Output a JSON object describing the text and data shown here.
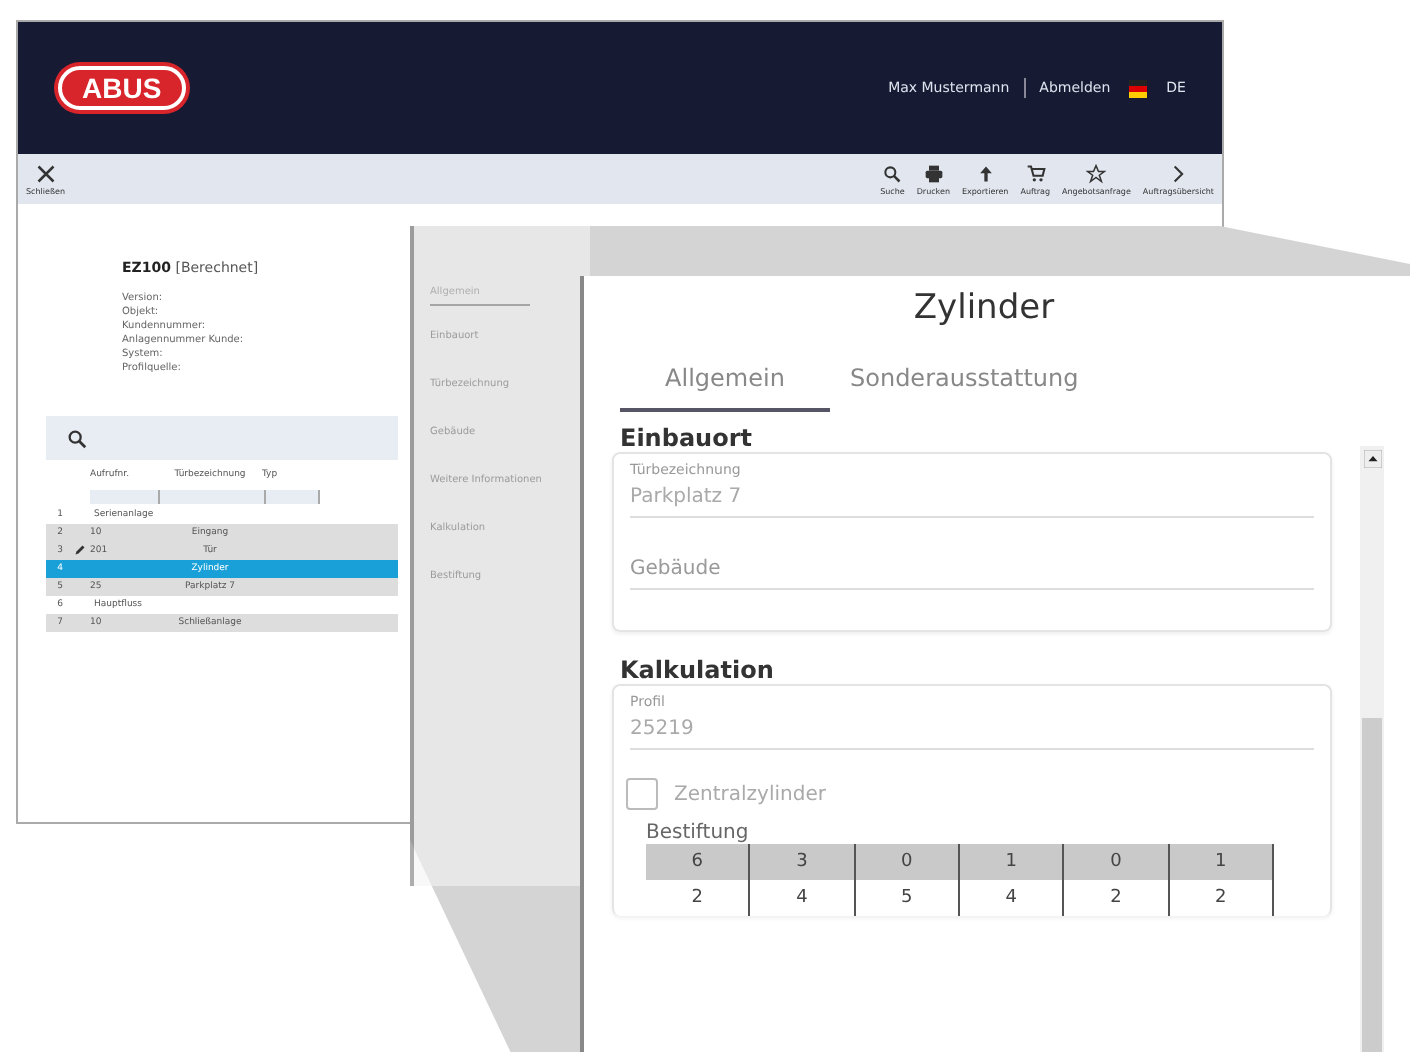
{
  "header": {
    "logo": "ABUS",
    "user": "Max Mustermann",
    "logout": "Abmelden",
    "language": "DE"
  },
  "toolbar": {
    "close": "Schließen",
    "actions": [
      {
        "kind": "search",
        "label": "Suche"
      },
      {
        "kind": "print",
        "label": "Drucken"
      },
      {
        "kind": "export",
        "label": "Exportieren"
      },
      {
        "kind": "cart",
        "label": "Auftrag"
      },
      {
        "kind": "star",
        "label": "Angebotsanfrage"
      },
      {
        "kind": "next",
        "label": "Auftragsübersicht"
      }
    ]
  },
  "object_card": {
    "title": "EZ100",
    "status": "[Berechnet]",
    "fields": [
      "Version:",
      "Objekt:",
      "Kundennummer:",
      "Anlagennummer Kunde:",
      "System:",
      "Profilquelle:"
    ]
  },
  "door_table": {
    "columns": [
      "Aufrufnr.",
      "Türbezeichnung",
      "Typ"
    ],
    "rows": [
      {
        "number": "1",
        "kind": "group",
        "editing": false,
        "selected": false,
        "cells": [
          "Serienanlage"
        ]
      },
      {
        "number": "2",
        "kind": "item",
        "editing": false,
        "selected": false,
        "cells": [
          "10",
          "Eingang"
        ]
      },
      {
        "number": "3",
        "kind": "item",
        "editing": true,
        "selected": false,
        "cells": [
          "201",
          "Tür"
        ]
      },
      {
        "number": "4",
        "kind": "item",
        "editing": false,
        "selected": true,
        "cells": [
          "",
          "Zylinder"
        ]
      },
      {
        "number": "5",
        "kind": "item",
        "editing": false,
        "selected": false,
        "cells": [
          "25",
          "Parkplatz 7"
        ]
      },
      {
        "number": "6",
        "kind": "group",
        "editing": false,
        "selected": false,
        "cells": [
          "Hauptfluss"
        ]
      },
      {
        "number": "7",
        "kind": "item",
        "editing": false,
        "selected": false,
        "cells": [
          "10",
          "Schließanlage"
        ]
      }
    ]
  },
  "side_panel": {
    "tab": "Allgemein",
    "items": [
      "Einbauort",
      "Türbezeichnung",
      "Gebäude",
      "Weitere Informationen",
      "Kalkulation",
      "Bestiftung"
    ]
  },
  "dialog": {
    "title": "Zylinder",
    "tabs": [
      {
        "label": "Allgemein",
        "selected": true
      },
      {
        "label": "Sonderausstattung",
        "selected": false
      }
    ],
    "sections": [
      {
        "heading": "Einbauort",
        "fields": [
          {
            "label": "Türbezeichnung",
            "value": "Parkplatz 7"
          },
          {
            "placeholder": "Gebäude"
          }
        ]
      },
      {
        "heading": "Kalkulation",
        "fields": [
          {
            "label": "Profil",
            "value": "25219"
          }
        ]
      }
    ],
    "checkbox": {
      "label": "Zentralzylinder",
      "checked": false
    },
    "pinning": {
      "label": "Bestiftung",
      "rows": [
        [
          "6",
          "3",
          "0",
          "1",
          "0",
          "1"
        ],
        [
          "2",
          "4",
          "5",
          "4",
          "2",
          "2"
        ]
      ]
    }
  }
}
